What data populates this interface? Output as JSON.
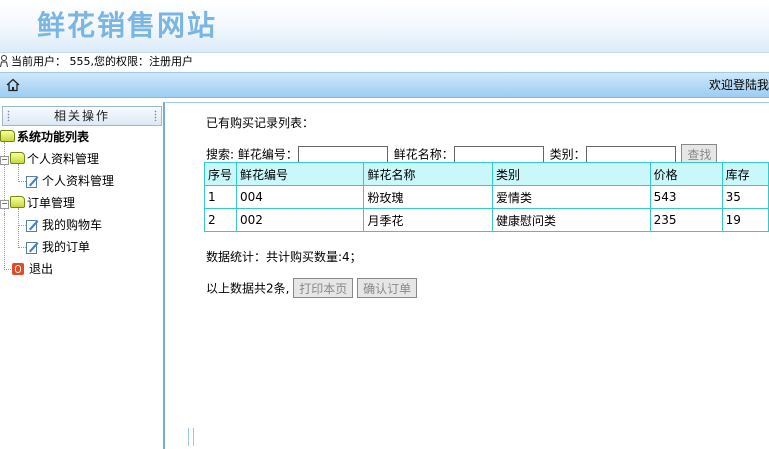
{
  "header": {
    "site_title": "鲜花销售网站"
  },
  "userbar": {
    "text": "当前用户： 555,您的权限：注册用户"
  },
  "navbar": {
    "welcome": "欢迎登陆我"
  },
  "sidebar": {
    "panel_title": "相关操作",
    "root": "系统功能列表",
    "groups": [
      {
        "label": "个人资料管理",
        "items": [
          {
            "label": "个人资料管理"
          }
        ]
      },
      {
        "label": "订单管理",
        "items": [
          {
            "label": "我的购物车"
          },
          {
            "label": "我的订单"
          }
        ]
      }
    ],
    "exit": "退出"
  },
  "main": {
    "list_title": "已有购买记录列表：",
    "search": {
      "label": "搜索:",
      "code_label": "鲜花编号：",
      "name_label": "鲜花名称：",
      "type_label": "类别：",
      "code_value": "",
      "name_value": "",
      "type_value": "",
      "button": "查找"
    },
    "table": {
      "headers": [
        "序号",
        "鲜花编号",
        "鲜花名称",
        "类别",
        "价格",
        "库存"
      ],
      "rows": [
        [
          "1",
          "004",
          "粉玫瑰",
          "爱情类",
          "543",
          "35"
        ],
        [
          "2",
          "002",
          "月季花",
          "健康慰问类",
          "235",
          "19"
        ]
      ]
    },
    "stats": "数据统计：共计购买数量:4；",
    "footer": {
      "text": "以上数据共2条,",
      "print_button": "打印本页",
      "confirm_button": "确认订单"
    }
  },
  "colors": {
    "title": "#7bb6e3",
    "table_border": "#37c7cf",
    "table_header_bg": "#c9f7fa",
    "nav_bg": "#9ccdf1"
  }
}
